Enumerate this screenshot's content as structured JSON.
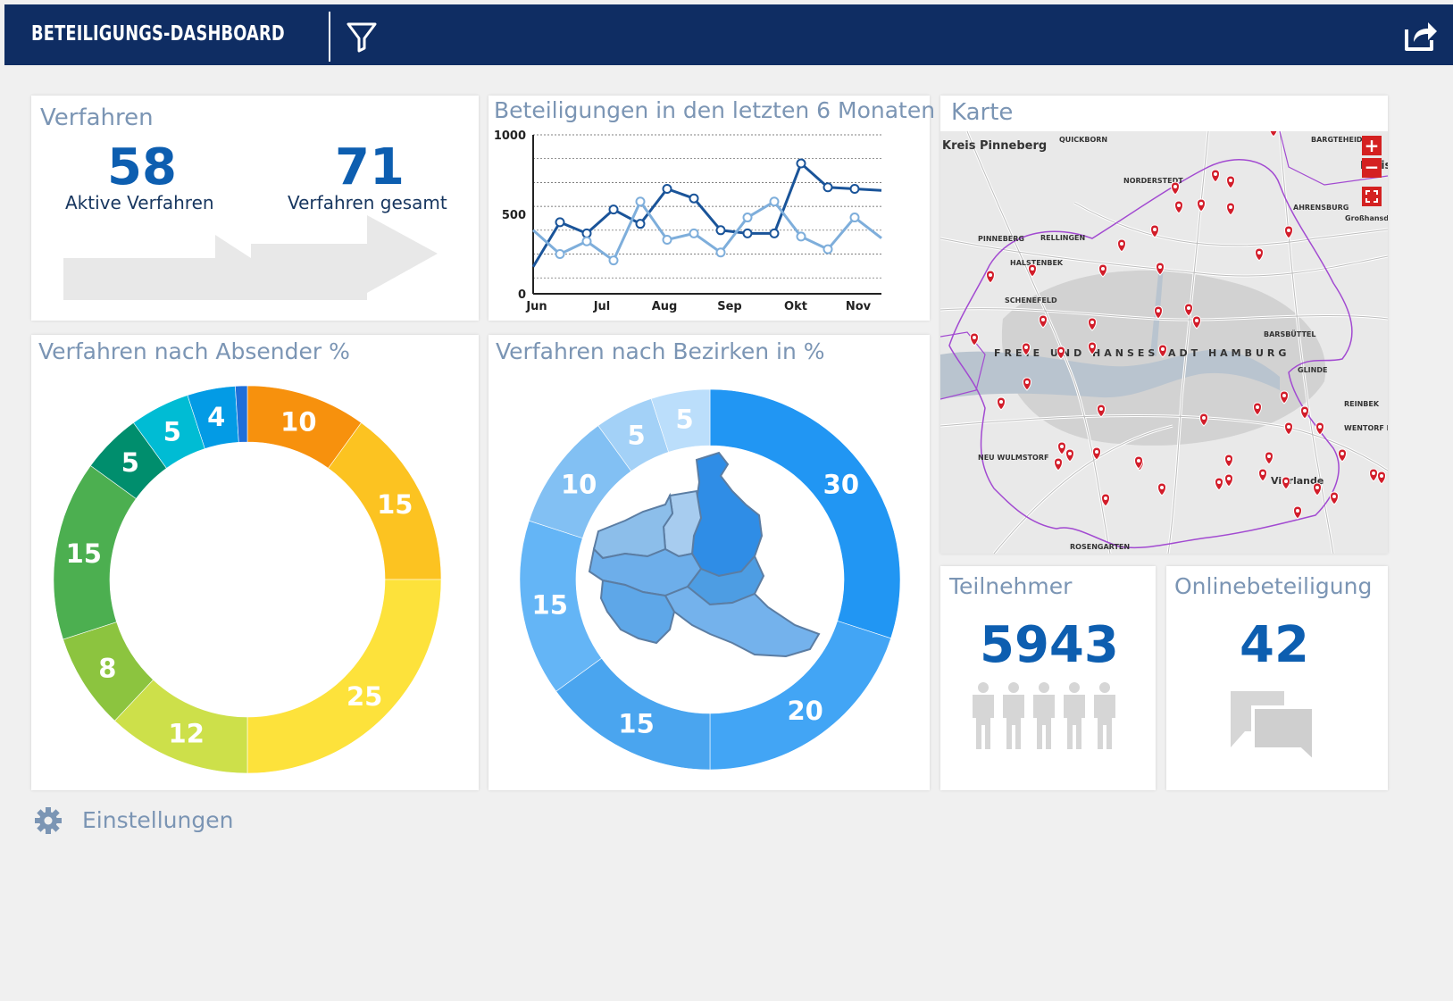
{
  "header": {
    "title": "BETEILIGUNGS-DASHBOARD",
    "filter_icon": "filter-icon",
    "share_icon": "share-icon",
    "bar_color": "#0f2d63"
  },
  "verfahren_card": {
    "title": "Verfahren",
    "active_count": "58",
    "active_label": "Aktive Verfahren",
    "total_count": "71",
    "total_label": "Verfahren gesamt"
  },
  "line_card": {
    "title": "Beteiligungen in den letzten 6 Monaten"
  },
  "map_card": {
    "title": "Karte",
    "zoom_in_icon": "plus-icon",
    "zoom_out_icon": "minus-icon",
    "fullscreen_icon": "fullscreen-icon",
    "place_labels": [
      "Kreis Pinneberg",
      "QUICKBORN",
      "NORDERSTEDT",
      "BARGTEHEIDE",
      "Kreis",
      "AHRENSBURG",
      "PINNEBERG",
      "RELLINGEN",
      "HALSTENBEK",
      "SCHENEFELD",
      "FREIE UND HANSESTADT HAMBURG",
      "BARSBÜTTEL",
      "GLINDE",
      "REINBEK",
      "WENTORF bei Hamburg",
      "NEU WULMSTORF",
      "ROSENGARTEN",
      "Vierlande",
      "Großhansdorf"
    ]
  },
  "absender_card": {
    "title": "Verfahren nach Absender %"
  },
  "bezirke_card": {
    "title": "Verfahren nach Bezirken in %"
  },
  "teilnehmer_card": {
    "title": "Teilnehmer",
    "value": "5943",
    "icon": "people-icon"
  },
  "online_card": {
    "title": "Onlinebeteiligung",
    "value": "42",
    "icon": "chat-bubbles-icon"
  },
  "footer": {
    "settings_label": "Einstellungen",
    "settings_icon": "gear-icon"
  },
  "chart_data": [
    {
      "type": "line",
      "title": "Beteiligungen in den letzten 6 Monaten",
      "x": [
        "Jun",
        "Jul",
        "Aug",
        "Sep",
        "Okt",
        "Nov"
      ],
      "x_points": [
        0,
        0.5,
        1,
        1.5,
        2,
        2.5,
        3,
        3.5,
        4,
        4.5,
        5,
        5.5
      ],
      "series": [
        {
          "color": "#1a5499",
          "values": [
            170,
            450,
            380,
            530,
            440,
            660,
            600,
            400,
            380,
            380,
            820,
            670,
            660,
            650
          ]
        },
        {
          "color": "#7eaedb",
          "values": [
            400,
            250,
            330,
            210,
            580,
            340,
            380,
            260,
            480,
            580,
            360,
            280,
            480,
            350
          ]
        }
      ],
      "ylim": [
        0,
        1000
      ],
      "yticks": [
        0,
        500,
        1000
      ],
      "grid": true
    },
    {
      "type": "pie",
      "title": "Verfahren nach Absender %",
      "values": [
        10,
        15,
        25,
        12,
        8,
        15,
        5,
        5,
        4,
        1
      ],
      "colors": [
        "#f7910d",
        "#fcc321",
        "#fde23b",
        "#cde04a",
        "#8cc43f",
        "#4caf50",
        "#008e6d",
        "#00bcd4",
        "#039be5",
        "#1e6fd9"
      ],
      "donut": true
    },
    {
      "type": "pie",
      "title": "Verfahren nach Bezirken in %",
      "values": [
        30,
        20,
        15,
        15,
        10,
        5,
        5
      ],
      "colors": [
        "#2196f3",
        "#42a5f5",
        "#4aa5ef",
        "#64b5f6",
        "#82c0f3",
        "#a3d1f7",
        "#bbdefb"
      ],
      "donut": true
    }
  ]
}
